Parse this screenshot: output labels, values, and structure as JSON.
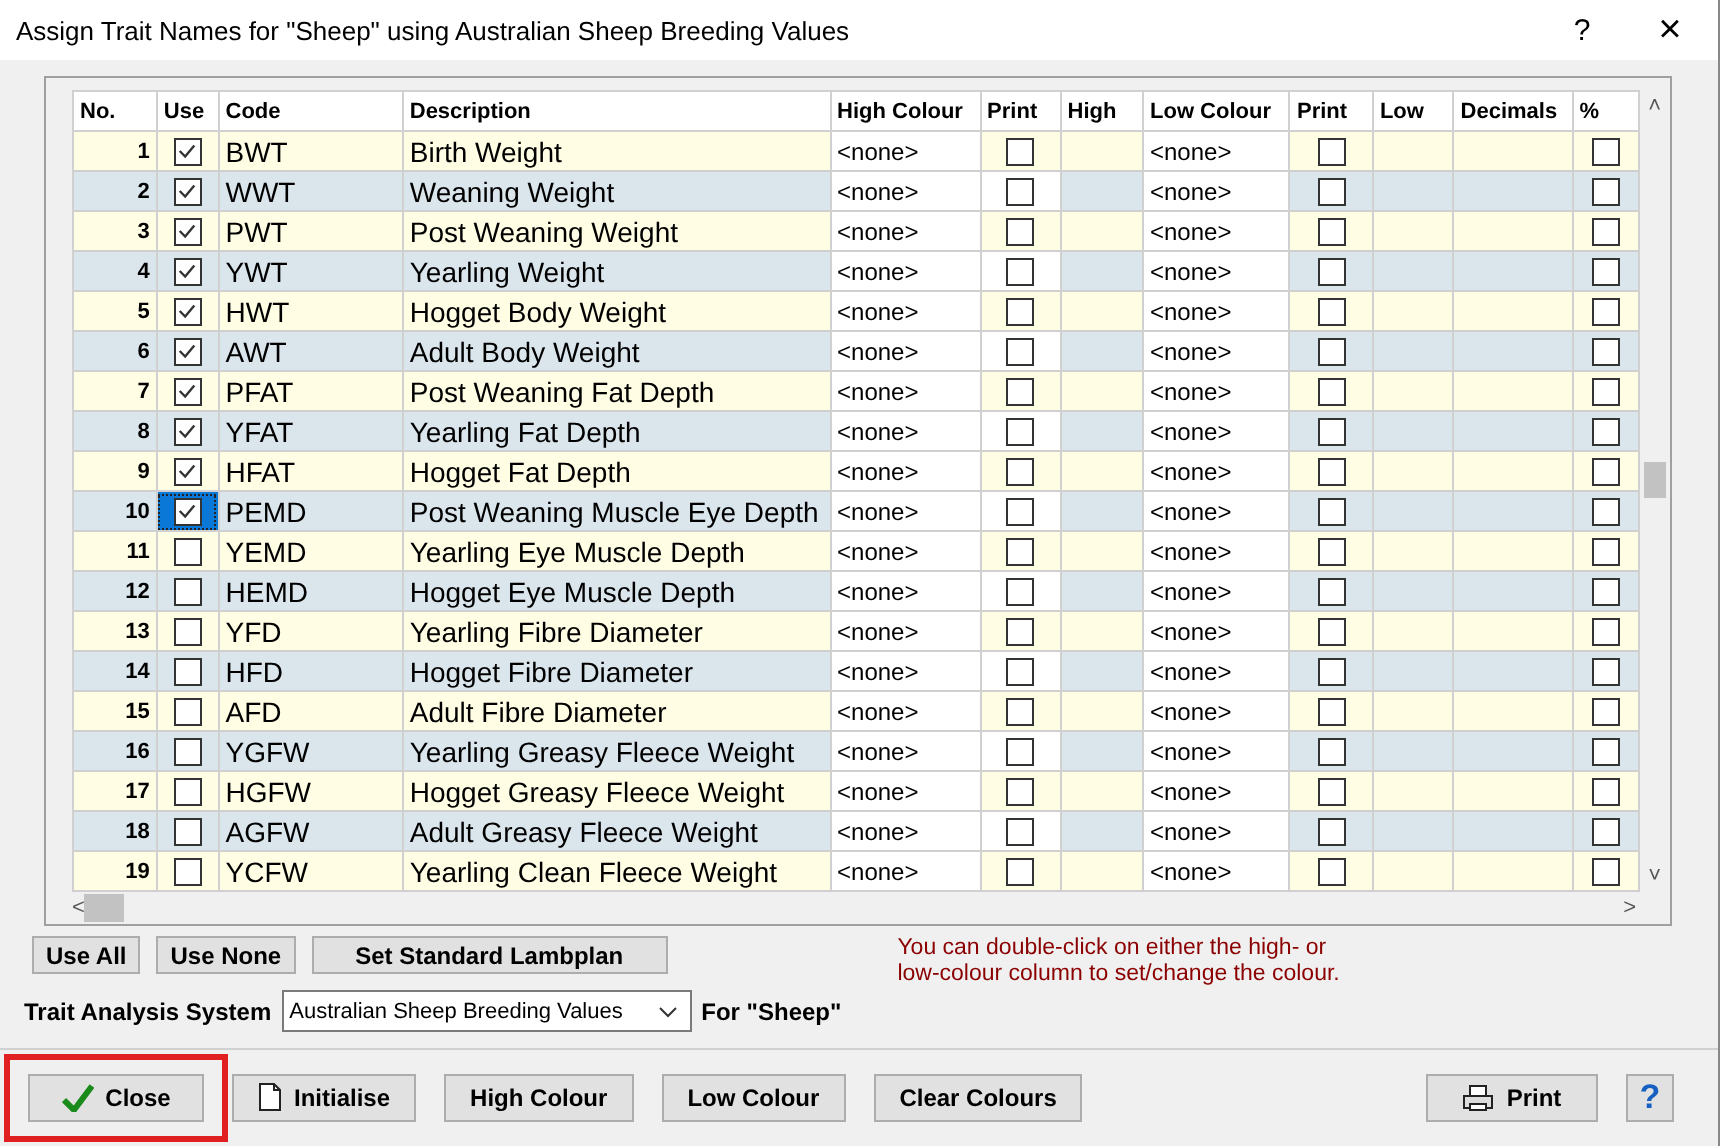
{
  "window": {
    "title": "Assign Trait Names for \"Sheep\" using Australian Sheep Breeding Values",
    "help_glyph": "?",
    "close_glyph": "×"
  },
  "table": {
    "columns": [
      "No.",
      "Use",
      "Code",
      "Description",
      "High Colour",
      "Print",
      "High",
      "Low Colour",
      "Print",
      "Low",
      "Decimals",
      "%"
    ],
    "rows": [
      {
        "no": "1",
        "use": true,
        "code": "BWT",
        "description": "Birth Weight",
        "high_colour": "<none>",
        "print_high": false,
        "low_colour": "<none>",
        "print_low": false,
        "percent": false,
        "focused": false
      },
      {
        "no": "2",
        "use": true,
        "code": "WWT",
        "description": "Weaning Weight",
        "high_colour": "<none>",
        "print_high": false,
        "low_colour": "<none>",
        "print_low": false,
        "percent": false,
        "focused": false
      },
      {
        "no": "3",
        "use": true,
        "code": "PWT",
        "description": "Post Weaning Weight",
        "high_colour": "<none>",
        "print_high": false,
        "low_colour": "<none>",
        "print_low": false,
        "percent": false,
        "focused": false
      },
      {
        "no": "4",
        "use": true,
        "code": "YWT",
        "description": "Yearling Weight",
        "high_colour": "<none>",
        "print_high": false,
        "low_colour": "<none>",
        "print_low": false,
        "percent": false,
        "focused": false
      },
      {
        "no": "5",
        "use": true,
        "code": "HWT",
        "description": "Hogget Body Weight",
        "high_colour": "<none>",
        "print_high": false,
        "low_colour": "<none>",
        "print_low": false,
        "percent": false,
        "focused": false
      },
      {
        "no": "6",
        "use": true,
        "code": "AWT",
        "description": "Adult Body Weight",
        "high_colour": "<none>",
        "print_high": false,
        "low_colour": "<none>",
        "print_low": false,
        "percent": false,
        "focused": false
      },
      {
        "no": "7",
        "use": true,
        "code": "PFAT",
        "description": "Post Weaning Fat Depth",
        "high_colour": "<none>",
        "print_high": false,
        "low_colour": "<none>",
        "print_low": false,
        "percent": false,
        "focused": false
      },
      {
        "no": "8",
        "use": true,
        "code": "YFAT",
        "description": "Yearling Fat Depth",
        "high_colour": "<none>",
        "print_high": false,
        "low_colour": "<none>",
        "print_low": false,
        "percent": false,
        "focused": false
      },
      {
        "no": "9",
        "use": true,
        "code": "HFAT",
        "description": "Hogget Fat Depth",
        "high_colour": "<none>",
        "print_high": false,
        "low_colour": "<none>",
        "print_low": false,
        "percent": false,
        "focused": false
      },
      {
        "no": "10",
        "use": true,
        "code": "PEMD",
        "description": "Post Weaning Muscle Eye Depth",
        "high_colour": "<none>",
        "print_high": false,
        "low_colour": "<none>",
        "print_low": false,
        "percent": false,
        "focused": true
      },
      {
        "no": "11",
        "use": false,
        "code": "YEMD",
        "description": "Yearling Eye Muscle Depth",
        "high_colour": "<none>",
        "print_high": false,
        "low_colour": "<none>",
        "print_low": false,
        "percent": false,
        "focused": false
      },
      {
        "no": "12",
        "use": false,
        "code": "HEMD",
        "description": "Hogget Eye Muscle Depth",
        "high_colour": "<none>",
        "print_high": false,
        "low_colour": "<none>",
        "print_low": false,
        "percent": false,
        "focused": false
      },
      {
        "no": "13",
        "use": false,
        "code": "YFD",
        "description": "Yearling Fibre Diameter",
        "high_colour": "<none>",
        "print_high": false,
        "low_colour": "<none>",
        "print_low": false,
        "percent": false,
        "focused": false
      },
      {
        "no": "14",
        "use": false,
        "code": "HFD",
        "description": "Hogget Fibre Diameter",
        "high_colour": "<none>",
        "print_high": false,
        "low_colour": "<none>",
        "print_low": false,
        "percent": false,
        "focused": false
      },
      {
        "no": "15",
        "use": false,
        "code": "AFD",
        "description": "Adult Fibre Diameter",
        "high_colour": "<none>",
        "print_high": false,
        "low_colour": "<none>",
        "print_low": false,
        "percent": false,
        "focused": false
      },
      {
        "no": "16",
        "use": false,
        "code": "YGFW",
        "description": "Yearling Greasy Fleece Weight",
        "high_colour": "<none>",
        "print_high": false,
        "low_colour": "<none>",
        "print_low": false,
        "percent": false,
        "focused": false
      },
      {
        "no": "17",
        "use": false,
        "code": "HGFW",
        "description": "Hogget Greasy Fleece Weight",
        "high_colour": "<none>",
        "print_high": false,
        "low_colour": "<none>",
        "print_low": false,
        "percent": false,
        "focused": false
      },
      {
        "no": "18",
        "use": false,
        "code": "AGFW",
        "description": "Adult Greasy Fleece Weight",
        "high_colour": "<none>",
        "print_high": false,
        "low_colour": "<none>",
        "print_low": false,
        "percent": false,
        "focused": false
      },
      {
        "no": "19",
        "use": false,
        "code": "YCFW",
        "description": "Yearling Clean Fleece Weight",
        "high_colour": "<none>",
        "print_high": false,
        "low_colour": "<none>",
        "print_low": false,
        "percent": false,
        "focused": false
      }
    ]
  },
  "scroll_glyphs": {
    "up": "˄",
    "down": "˅",
    "left": "<",
    "right": ">"
  },
  "actions": [
    "Use All",
    "Use None",
    "Set Standard Lambplan"
  ],
  "note": "You can double-click on either the high- or low-colour column to set/change the colour.",
  "trait_system": {
    "label": "Trait Analysis System",
    "value": "Australian Sheep Breeding Values",
    "for_label": "For \"Sheep\""
  },
  "footer": [
    {
      "kind": "close",
      "label": "Close",
      "highlighted": true
    },
    {
      "kind": "initialise",
      "label": "Initialise",
      "highlighted": false
    },
    {
      "kind": "plain",
      "label": "High Colour",
      "highlighted": false
    },
    {
      "kind": "plain",
      "label": "Low Colour",
      "highlighted": false
    },
    {
      "kind": "plain",
      "label": "Clear Colours",
      "highlighted": false
    },
    {
      "kind": "print",
      "label": "Print",
      "highlighted": false
    },
    {
      "kind": "help",
      "label": "?",
      "highlighted": false
    }
  ]
}
